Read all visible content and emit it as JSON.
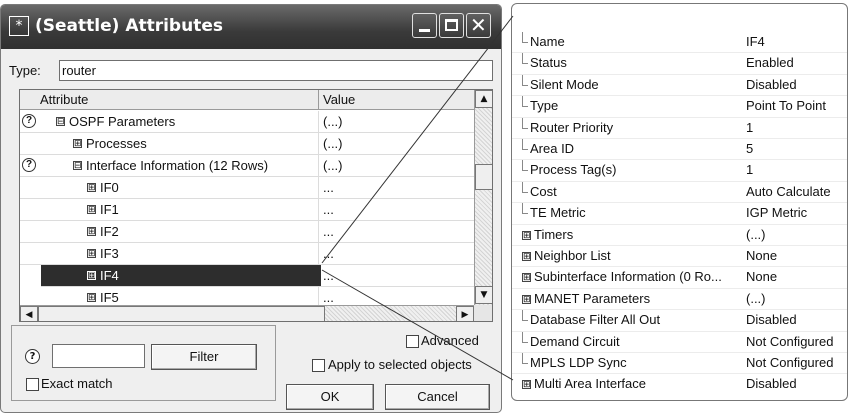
{
  "dialog": {
    "title": "(Seattle) Attributes",
    "app_icon": "*",
    "type_label": "Type:",
    "type_value": "router",
    "columns": {
      "attribute": "Attribute",
      "value": "Value"
    },
    "rows": [
      {
        "label": "OSPF Parameters",
        "value": "(...)",
        "help": "?",
        "exp": "⊟"
      },
      {
        "label": "Processes",
        "value": "(...)",
        "exp": "⊞"
      },
      {
        "label": "Interface Information (12 Rows)",
        "value": "(...)",
        "help": "?",
        "exp": "⊟"
      },
      {
        "label": "IF0",
        "value": "...",
        "exp": "⊞"
      },
      {
        "label": "IF1",
        "value": "...",
        "exp": "⊞"
      },
      {
        "label": "IF2",
        "value": "...",
        "exp": "⊞"
      },
      {
        "label": "IF3",
        "value": "...",
        "exp": "⊞"
      },
      {
        "label": "IF4",
        "value": "...",
        "exp": "⊞",
        "selected": true
      },
      {
        "label": "IF5",
        "value": "...",
        "exp": "⊞"
      }
    ],
    "help_glyph": "?",
    "filter_label": "Filter",
    "exact_match_label": "Exact match",
    "advanced_label": "Advanced",
    "apply_label": "Apply to selected objects",
    "ok_label": "OK",
    "cancel_label": "Cancel",
    "scroll_up": "▲",
    "scroll_down": "▼",
    "scroll_left": "◀",
    "scroll_right": "▶"
  },
  "panel": {
    "rows": [
      {
        "name": "Name",
        "value": "IF4"
      },
      {
        "name": "Status",
        "value": "Enabled"
      },
      {
        "name": "Silent Mode",
        "value": "Disabled"
      },
      {
        "name": "Type",
        "value": "Point To Point"
      },
      {
        "name": "Router Priority",
        "value": "1"
      },
      {
        "name": "Area ID",
        "value": "5"
      },
      {
        "name": "Process Tag(s)",
        "value": "1"
      },
      {
        "name": "Cost",
        "value": "Auto Calculate"
      },
      {
        "name": "TE Metric",
        "value": "IGP Metric"
      },
      {
        "name": "Timers",
        "value": "(...)",
        "expandable": true
      },
      {
        "name": "Neighbor List",
        "value": "None",
        "expandable": true
      },
      {
        "name": "Subinterface Information (0 Ro...",
        "value": "None",
        "expandable": true
      },
      {
        "name": "MANET Parameters",
        "value": "(...)",
        "expandable": true
      },
      {
        "name": "Database Filter All Out",
        "value": "Disabled"
      },
      {
        "name": "Demand Circuit",
        "value": "Not Configured"
      },
      {
        "name": "MPLS LDP Sync",
        "value": "Not Configured"
      },
      {
        "name": "Multi Area Interface",
        "value": "Disabled",
        "expandable": true
      }
    ],
    "expand_glyph": "⊞"
  }
}
